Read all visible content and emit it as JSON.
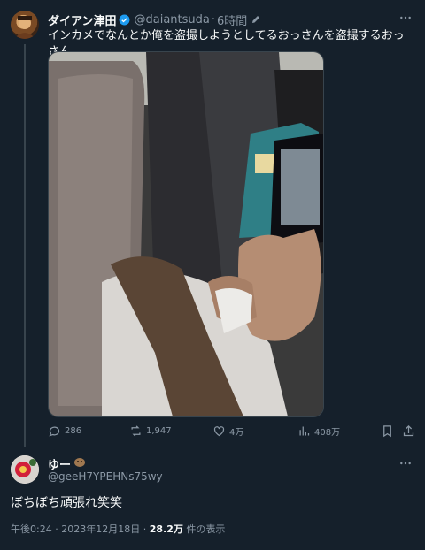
{
  "post": {
    "display_name": "ダイアン津田",
    "handle": "@daiantsuda",
    "time": "6時間",
    "text": "インカメでなんとか俺を盗撮しようとしてるおっさんを盗撮するおっさん",
    "stats": {
      "replies": "286",
      "reposts": "1,947",
      "likes": "4万",
      "views": "408万"
    }
  },
  "reply": {
    "display_name": "ゆー",
    "handle": "@geeH7YPEHNs75wy",
    "text": "ぼちぼち頑張れ笑笑",
    "time": "午後0:24",
    "date": "2023年12月18日",
    "views_count": "28.2万",
    "views_label": "件の表示"
  },
  "colors": {
    "background": "#15202b",
    "text": "#f7f9f9",
    "muted": "#8b98a5",
    "accent": "#1d9bf0"
  }
}
